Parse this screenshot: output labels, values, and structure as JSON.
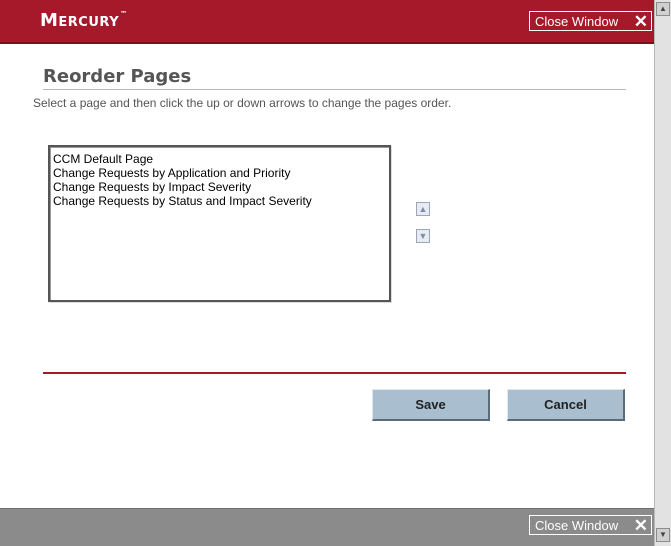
{
  "header": {
    "brand": "Mercury",
    "trademark": "™",
    "close_label": "Close Window",
    "close_glyph": "✕"
  },
  "page": {
    "title": "Reorder Pages",
    "instructions": "Select a page and then click the up or down arrows to change the pages order."
  },
  "list": {
    "items": [
      "CCM Default Page",
      "Change Requests by Application and Priority",
      "Change Requests by Impact Severity",
      "Change Requests by Status and Impact Severity"
    ]
  },
  "arrows": {
    "up_glyph": "▲",
    "down_glyph": "▼"
  },
  "actions": {
    "save_label": "Save",
    "cancel_label": "Cancel"
  },
  "footer": {
    "close_label": "Close Window",
    "close_glyph": "✕"
  },
  "scrollbar": {
    "up_glyph": "▲",
    "down_glyph": "▼"
  },
  "colors": {
    "brand_red": "#a5192b",
    "button_blue": "#a9bfd0",
    "footer_gray": "#8b8b8b"
  }
}
